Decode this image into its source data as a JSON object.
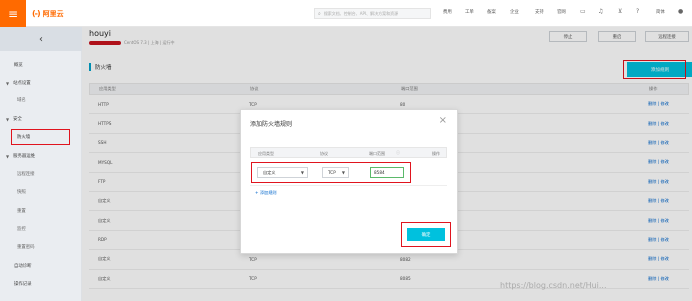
{
  "topbar": {
    "menu_icon": "hamburger-icon",
    "brand_logo": "(-)",
    "brand_name": "阿里云",
    "search_placeholder": "搜索文档、控制台、API、解决方案和资源",
    "nav": [
      "费用",
      "工单",
      "备案",
      "企业",
      "支持",
      "官网"
    ],
    "icons": [
      "terminal-icon",
      "bell-icon",
      "cart-icon",
      "help-icon",
      "user-icon"
    ],
    "lang": "简体"
  },
  "sidebar": {
    "collapse_icon": "chevron-left-icon",
    "items": [
      {
        "label": "概览",
        "kind": "top"
      },
      {
        "label": "站点设置",
        "kind": "group"
      },
      {
        "label": "域名",
        "kind": "sub"
      },
      {
        "label": "安全",
        "kind": "group"
      },
      {
        "label": "防火墙",
        "kind": "sub"
      },
      {
        "label": "服务器运维",
        "kind": "group"
      },
      {
        "label": "远程连接",
        "kind": "sub"
      },
      {
        "label": "快照",
        "kind": "sub"
      },
      {
        "label": "重置",
        "kind": "sub"
      },
      {
        "label": "监控",
        "kind": "sub"
      },
      {
        "label": "重置密码",
        "kind": "sub"
      },
      {
        "label": "自动诊断",
        "kind": "top"
      },
      {
        "label": "操作记录",
        "kind": "top"
      }
    ]
  },
  "main": {
    "title": "houyi",
    "subinfo": "CentOS 7.3 | 上海 | 运行中",
    "buttons": [
      "停止",
      "重启",
      "远程连接"
    ],
    "section_title": "防火墙",
    "add_button": "添加规则",
    "table": {
      "headers": [
        "应用类型",
        "协议",
        "端口范围",
        "操作"
      ],
      "rows": [
        [
          "HTTP",
          "TCP",
          "80",
          "删除 | 修改"
        ],
        [
          "HTTPS",
          "TCP",
          "443",
          "删除 | 修改"
        ],
        [
          "SSH",
          "TCP",
          "22",
          "删除 | 修改"
        ],
        [
          "MYSQL",
          "TCP",
          "3306",
          "删除 | 修改"
        ],
        [
          "FTP",
          "TCP",
          "21",
          "删除 | 修改"
        ],
        [
          "自定义",
          "TCP",
          "8080",
          "删除 | 修改"
        ],
        [
          "自定义",
          "TCP",
          "8081",
          "删除 | 修改"
        ],
        [
          "RDP",
          "TCP",
          "3389",
          "删除 | 修改"
        ],
        [
          "自定义",
          "TCP",
          "8082",
          "删除 | 修改"
        ],
        [
          "自定义",
          "TCP",
          "8085",
          "删除 | 修改"
        ]
      ]
    }
  },
  "modal": {
    "title": "添加防火墙规则",
    "close_icon": "close-icon",
    "headers": [
      "应用类型",
      "协议",
      "端口范围",
      "操作"
    ],
    "app_type": "自定义",
    "protocol": "TCP",
    "port": "8584",
    "add_rule": "+ 添加规则",
    "confirm": "确定"
  },
  "watermark": "https://blog.csdn.net/Hui..."
}
